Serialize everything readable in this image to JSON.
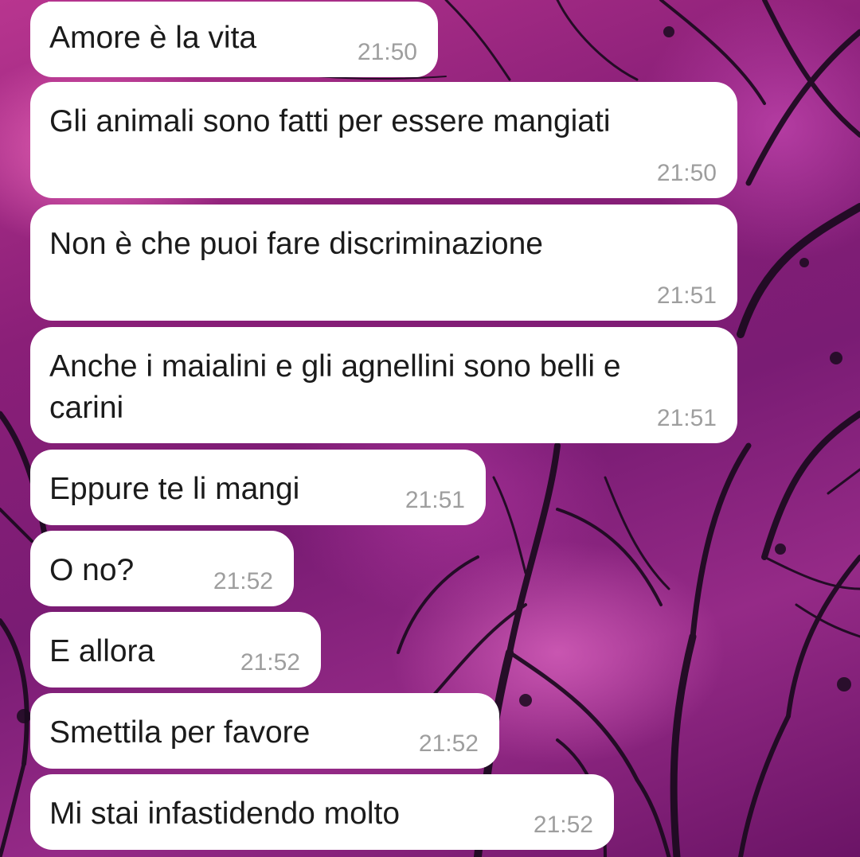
{
  "colors": {
    "bubble": "#ffffff",
    "text": "#1b1b1b",
    "timestamp": "#9e9e9e",
    "wallpaper": "#8a1f78"
  },
  "wallpaper": {
    "icon": "bare-tree-branches-magenta-sky"
  },
  "messages": [
    {
      "text": "Amore è la vita",
      "time": "21:50"
    },
    {
      "text": "Gli animali sono fatti per essere mangiati",
      "time": "21:50"
    },
    {
      "text": "Non è che puoi fare discriminazione",
      "time": "21:51"
    },
    {
      "text": "Anche i maialini e gli agnellini sono belli e carini",
      "time": "21:51"
    },
    {
      "text": "Eppure te li mangi",
      "time": "21:51"
    },
    {
      "text": "O no?",
      "time": "21:52"
    },
    {
      "text": "E allora",
      "time": "21:52"
    },
    {
      "text": "Smettila per favore",
      "time": "21:52"
    },
    {
      "text": "Mi stai infastidendo molto",
      "time": "21:52"
    }
  ]
}
